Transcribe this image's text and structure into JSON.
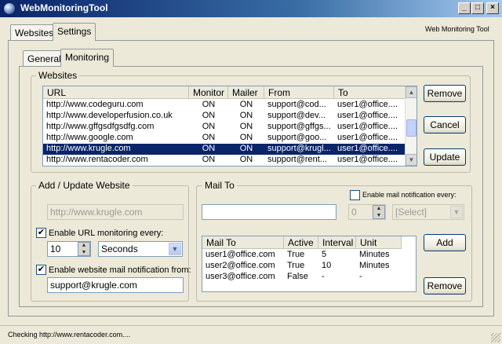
{
  "window": {
    "title": "WebMonitoringTool",
    "controls": [
      "_",
      "□",
      "×"
    ]
  },
  "top_tabs": [
    "Websites",
    "Settings"
  ],
  "brand_label": "Web Monitoring Tool",
  "settings_tabs": [
    "General",
    "Monitoring"
  ],
  "websites": {
    "title": "Websites",
    "columns": [
      "URL",
      "Monitor",
      "Mailer",
      "From",
      "To"
    ],
    "rows": [
      [
        "http://www.codeguru.com",
        "ON",
        "ON",
        "support@cod...",
        "user1@office...."
      ],
      [
        "http://www.developerfusion.co.uk",
        "ON",
        "ON",
        "support@dev...",
        "user1@office...."
      ],
      [
        "http://www.gffgsdfgsdfg.com",
        "ON",
        "ON",
        "support@gffgs...",
        "user1@office...."
      ],
      [
        "http://www.google.com",
        "ON",
        "ON",
        "support@goo...",
        "user1@office...."
      ],
      [
        "http://www.krugle.com",
        "ON",
        "ON",
        "support@krugl...",
        "user1@office...."
      ],
      [
        "http://www.rentacoder.com",
        "ON",
        "ON",
        "support@rent...",
        "user1@office...."
      ]
    ],
    "selected_row": 4,
    "buttons": {
      "remove": "Remove",
      "cancel": "Cancel",
      "update": "Update"
    }
  },
  "add_update": {
    "title": "Add / Update Website",
    "url_value": "http://www.krugle.com",
    "enable_url_monitoring_label": "Enable URL monitoring every:",
    "enable_url_monitoring_checked": true,
    "interval_value": "10",
    "unit_value": "Seconds",
    "enable_mail_label": "Enable website mail notification from:",
    "enable_mail_checked": true,
    "mail_from_value": "support@krugle.com"
  },
  "mail_to": {
    "title": "Mail To",
    "input_value": "",
    "enable_mail_every_label": "Enable mail notification every:",
    "enable_mail_every_checked": false,
    "every_value": "0",
    "select_placeholder": "[Select]",
    "columns": [
      "Mail To",
      "Active",
      "Interval",
      "Unit"
    ],
    "rows": [
      [
        "user1@office.com",
        "True",
        "5",
        "Minutes"
      ],
      [
        "user2@office.com",
        "True",
        "10",
        "Minutes"
      ],
      [
        "user3@office.com",
        "False",
        "-",
        "-"
      ]
    ],
    "buttons": {
      "add": "Add",
      "remove": "Remove"
    }
  },
  "status": {
    "text": "Checking http://www.rentacoder.com...."
  },
  "colors": {
    "title_bar": "#0a246a",
    "selection": "#0a246a",
    "face": "#ece9d8"
  }
}
